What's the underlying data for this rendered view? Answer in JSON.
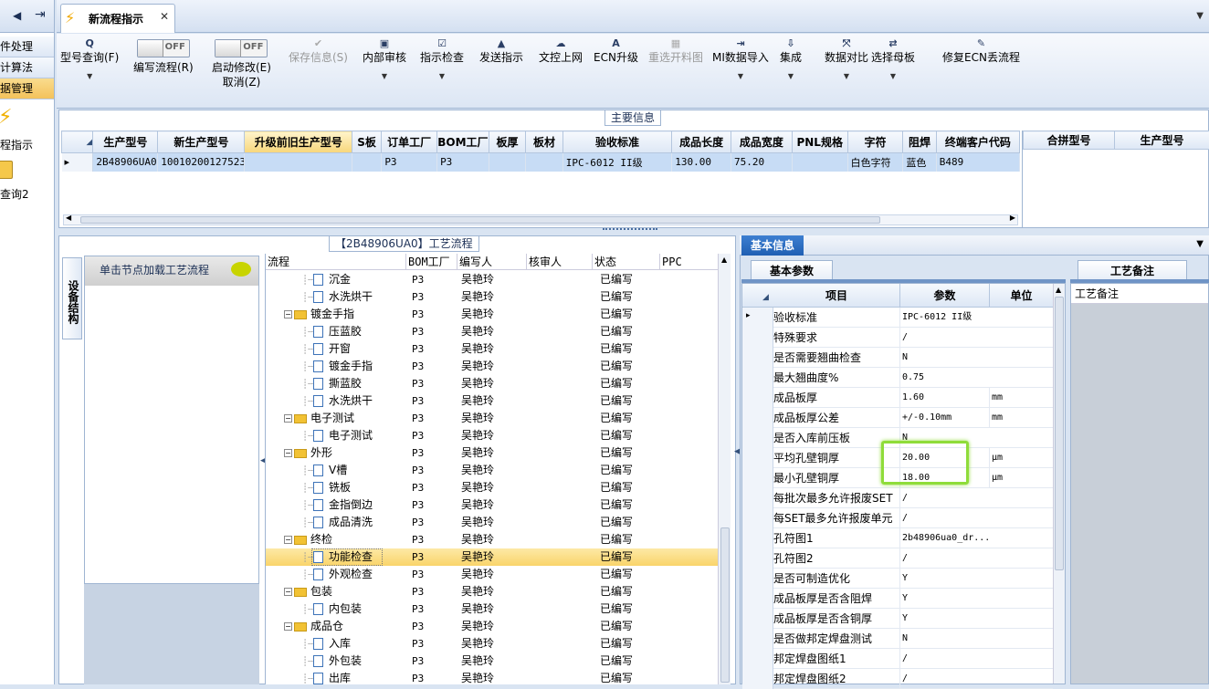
{
  "leftnav": {
    "items": [
      {
        "label": "件处理"
      },
      {
        "label": "计算法"
      },
      {
        "label": "据管理"
      }
    ],
    "item1": "程指示",
    "item2": "查询2"
  },
  "tabs": [
    {
      "label": "新流程指示"
    }
  ],
  "toolbar": {
    "items": [
      {
        "label": "型号查询(F)",
        "icon": "Q"
      },
      {
        "label": "编写流程(R)",
        "toggle": "OFF"
      },
      {
        "label": "启动修改(E)",
        "sublabel": "取消(Z)",
        "toggle": "OFF"
      },
      {
        "label": "保存信息(S)",
        "icon": "✔"
      },
      {
        "label": "内部审核",
        "icon": "▣"
      },
      {
        "label": "指示检查",
        "icon": "☑"
      },
      {
        "label": "发送指示",
        "icon": "▲"
      },
      {
        "label": "文控上网",
        "icon": "☁"
      },
      {
        "label": "ECN升级",
        "icon": "A"
      },
      {
        "label": "重选开料图",
        "icon": "▦"
      },
      {
        "label": "MI数据导入",
        "icon": "⇥"
      },
      {
        "label": "集成",
        "icon": "⇩"
      },
      {
        "label": "数据对比",
        "icon": "⤧"
      },
      {
        "label": "选择母板",
        "icon": "⇄"
      },
      {
        "label": "修复ECN丢流程",
        "icon": "✎"
      }
    ]
  },
  "main": {
    "title": "主要信息",
    "columns": [
      "生产型号",
      "新生产型号",
      "升级前旧生产型号",
      "S板",
      "订单工厂",
      "BOM工厂",
      "板厚",
      "板材",
      "验收标准",
      "成品长度",
      "成品宽度",
      "PNL规格",
      "字符",
      "阻焊",
      "终端客户代码"
    ],
    "row": [
      "2B48906UA0",
      "10010200127523",
      "",
      "",
      "P3",
      "P3",
      "",
      "",
      "IPC-6012 II级",
      "130.00",
      "75.20",
      "",
      "白色字符",
      "蓝色",
      "B489"
    ],
    "side_columns": [
      "合拼型号",
      "生产型号"
    ]
  },
  "process": {
    "title": "【2B48906UA0】工艺流程",
    "side_tab": "设备结构",
    "click_hint": "单击节点加载工艺流程",
    "columns": [
      "流程",
      "BOM工厂",
      "编写人",
      "核审人",
      "状态",
      "PPC"
    ],
    "rows": [
      {
        "name": "沉金",
        "lvl": 1,
        "f": "P3",
        "w": "吴艳玲",
        "s": "已编写"
      },
      {
        "name": "水洗烘干",
        "lvl": 1,
        "f": "P3",
        "w": "吴艳玲",
        "s": "已编写"
      },
      {
        "name": "镀金手指",
        "lvl": 0,
        "f": "P3",
        "w": "吴艳玲",
        "s": "已编写"
      },
      {
        "name": "压蓝胶",
        "lvl": 1,
        "f": "P3",
        "w": "吴艳玲",
        "s": "已编写"
      },
      {
        "name": "开窗",
        "lvl": 1,
        "f": "P3",
        "w": "吴艳玲",
        "s": "已编写"
      },
      {
        "name": "镀金手指",
        "lvl": 1,
        "f": "P3",
        "w": "吴艳玲",
        "s": "已编写"
      },
      {
        "name": "撕蓝胶",
        "lvl": 1,
        "f": "P3",
        "w": "吴艳玲",
        "s": "已编写"
      },
      {
        "name": "水洗烘干",
        "lvl": 1,
        "f": "P3",
        "w": "吴艳玲",
        "s": "已编写"
      },
      {
        "name": "电子测试",
        "lvl": 0,
        "f": "P3",
        "w": "吴艳玲",
        "s": "已编写"
      },
      {
        "name": "电子测试",
        "lvl": 1,
        "f": "P3",
        "w": "吴艳玲",
        "s": "已编写"
      },
      {
        "name": "外形",
        "lvl": 0,
        "f": "P3",
        "w": "吴艳玲",
        "s": "已编写"
      },
      {
        "name": "V槽",
        "lvl": 1,
        "f": "P3",
        "w": "吴艳玲",
        "s": "已编写"
      },
      {
        "name": "铣板",
        "lvl": 1,
        "f": "P3",
        "w": "吴艳玲",
        "s": "已编写"
      },
      {
        "name": "金指倒边",
        "lvl": 1,
        "f": "P3",
        "w": "吴艳玲",
        "s": "已编写"
      },
      {
        "name": "成品清洗",
        "lvl": 1,
        "f": "P3",
        "w": "吴艳玲",
        "s": "已编写"
      },
      {
        "name": "终检",
        "lvl": 0,
        "f": "P3",
        "w": "吴艳玲",
        "s": "已编写"
      },
      {
        "name": "功能检查",
        "lvl": 1,
        "f": "P3",
        "w": "吴艳玲",
        "s": "已编写",
        "sel": true
      },
      {
        "name": "外观检查",
        "lvl": 1,
        "f": "P3",
        "w": "吴艳玲",
        "s": "已编写"
      },
      {
        "name": "包装",
        "lvl": 0,
        "f": "P3",
        "w": "吴艳玲",
        "s": "已编写"
      },
      {
        "name": "内包装",
        "lvl": 1,
        "f": "P3",
        "w": "吴艳玲",
        "s": "已编写"
      },
      {
        "name": "成品仓",
        "lvl": 0,
        "f": "P3",
        "w": "吴艳玲",
        "s": "已编写"
      },
      {
        "name": "入库",
        "lvl": 1,
        "f": "P3",
        "w": "吴艳玲",
        "s": "已编写"
      },
      {
        "name": "外包装",
        "lvl": 1,
        "f": "P3",
        "w": "吴艳玲",
        "s": "已编写"
      },
      {
        "name": "出库",
        "lvl": 1,
        "f": "P3",
        "w": "吴艳玲",
        "s": "已编写"
      }
    ]
  },
  "basic": {
    "tab": "基本信息",
    "param_tab": "基本参数",
    "notes_tab": "工艺备注",
    "notes_header": "工艺备注",
    "columns": [
      "项目",
      "参数",
      "单位"
    ],
    "rows": [
      {
        "k": "验收标准",
        "v": "IPC-6012 II级",
        "u": ""
      },
      {
        "k": "特殊要求",
        "v": "/",
        "u": ""
      },
      {
        "k": "是否需要翘曲检查",
        "v": "N",
        "u": ""
      },
      {
        "k": "最大翘曲度%",
        "v": "0.75",
        "u": ""
      },
      {
        "k": "成品板厚",
        "v": "1.60",
        "u": "mm"
      },
      {
        "k": "成品板厚公差",
        "v": "+/-0.10mm",
        "u": "mm"
      },
      {
        "k": "是否入库前压板",
        "v": "N",
        "u": ""
      },
      {
        "k": "平均孔壁铜厚",
        "v": "20.00",
        "u": "μm"
      },
      {
        "k": "最小孔壁铜厚",
        "v": "18.00",
        "u": "μm"
      },
      {
        "k": "每批次最多允许报废SET",
        "v": "/",
        "u": ""
      },
      {
        "k": "每SET最多允许报废单元",
        "v": "/",
        "u": ""
      },
      {
        "k": "孔符图1",
        "v": "2b48906ua0_dr...",
        "u": ""
      },
      {
        "k": "孔符图2",
        "v": "/",
        "u": ""
      },
      {
        "k": "是否可制造优化",
        "v": "Y",
        "u": ""
      },
      {
        "k": "成品板厚是否含阻焊",
        "v": "Y",
        "u": ""
      },
      {
        "k": "成品板厚是否含铜厚",
        "v": "Y",
        "u": ""
      },
      {
        "k": "是否做邦定焊盘测试",
        "v": "N",
        "u": ""
      },
      {
        "k": "邦定焊盘图纸1",
        "v": "/",
        "u": ""
      },
      {
        "k": "邦定焊盘图纸2",
        "v": "/",
        "u": ""
      }
    ]
  }
}
